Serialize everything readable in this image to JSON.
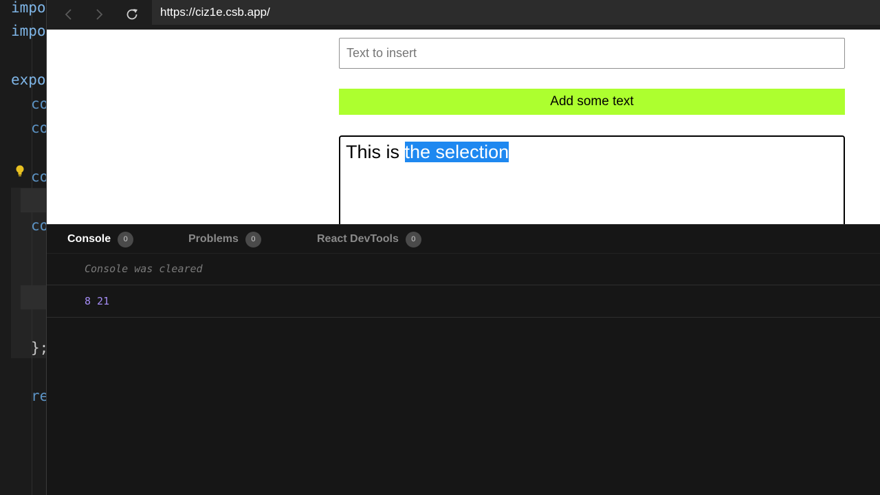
{
  "editor": {
    "lines": [
      "impo",
      "impo",
      "expo",
      "co",
      "co",
      "co",
      "co",
      "};",
      "re"
    ]
  },
  "browser": {
    "url": "https://ciz1e.csb.app/"
  },
  "preview": {
    "input_placeholder": "Text to insert",
    "add_button_label": "Add some text",
    "editable_text_before": "This is ",
    "editable_text_selected": "the selection"
  },
  "devtools": {
    "tabs": [
      {
        "label": "Console",
        "count": "0"
      },
      {
        "label": "Problems",
        "count": "0"
      },
      {
        "label": "React DevTools",
        "count": "0"
      }
    ],
    "console_cleared": "Console was cleared",
    "console_log": "8 21"
  },
  "colors": {
    "button_bg": "#adff2f",
    "selection_bg": "#1e88f0",
    "log_text": "#a48cf5"
  }
}
